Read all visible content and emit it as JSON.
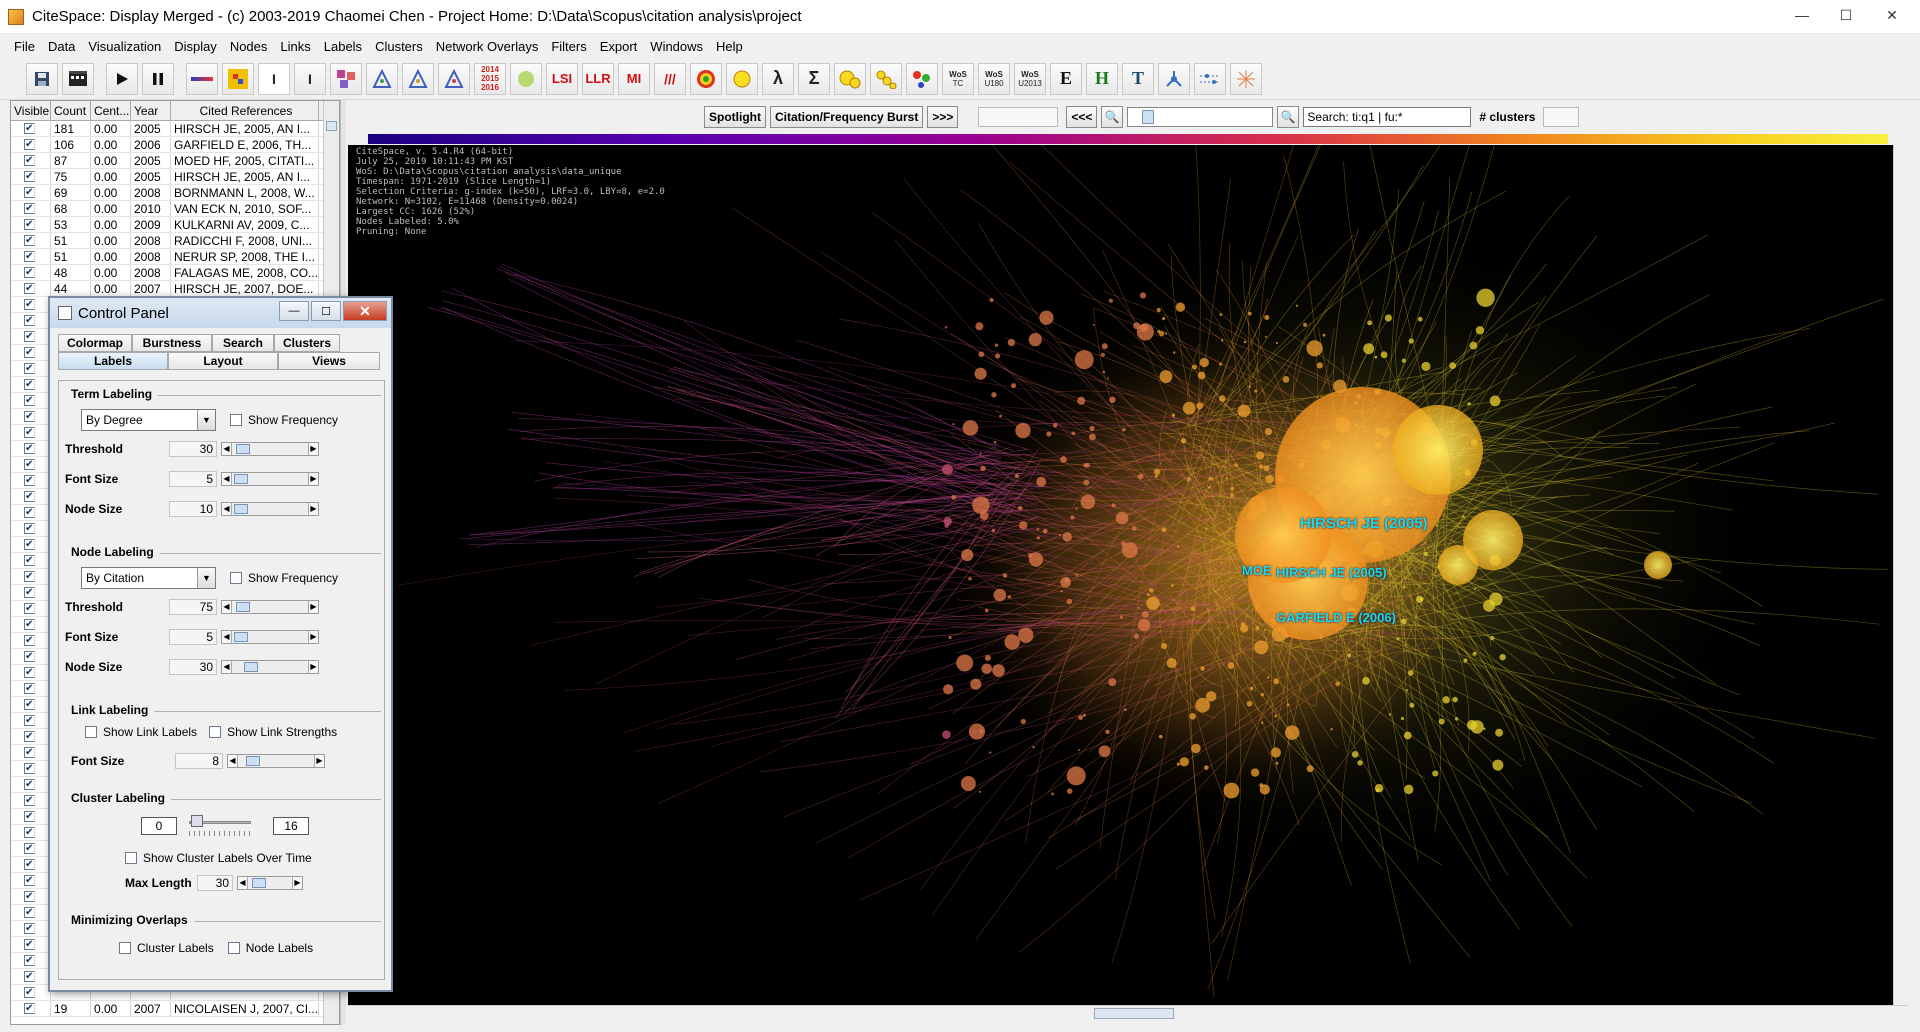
{
  "window": {
    "title": "CiteSpace: Display Merged - (c) 2003-2019 Chaomei Chen - Project Home: D:\\Data\\Scopus\\citation analysis\\project",
    "minimize": "—",
    "maximize": "☐",
    "close": "✕"
  },
  "menu": [
    "File",
    "Data",
    "Visualization",
    "Display",
    "Nodes",
    "Links",
    "Labels",
    "Clusters",
    "Network Overlays",
    "Filters",
    "Export",
    "Windows",
    "Help"
  ],
  "toolbar": {
    "year_stack": [
      "2014",
      "2015",
      "2016"
    ],
    "lsi": "LSI",
    "llr": "LLR",
    "mi": "MI",
    "lambda": "λ",
    "sigma": "Σ",
    "wos_tc": [
      "WoS",
      "TC"
    ],
    "wos_u180": [
      "WoS",
      "U180"
    ],
    "wos_u2013": [
      "WoS",
      "U2013"
    ],
    "e": "E",
    "h": "H",
    "t": "T"
  },
  "table": {
    "headers": [
      "Visible",
      "Count",
      "Cent...",
      "Year",
      "Cited References"
    ],
    "rows": [
      {
        "count": "181",
        "cent": "0.00",
        "year": "2005",
        "ref": "HIRSCH JE, 2005, AN I..."
      },
      {
        "count": "106",
        "cent": "0.00",
        "year": "2006",
        "ref": "GARFIELD E, 2006, TH..."
      },
      {
        "count": "87",
        "cent": "0.00",
        "year": "2005",
        "ref": "MOED HF, 2005, CITATI..."
      },
      {
        "count": "75",
        "cent": "0.00",
        "year": "2005",
        "ref": "HIRSCH JE, 2005, AN I..."
      },
      {
        "count": "69",
        "cent": "0.00",
        "year": "2008",
        "ref": "BORNMANN L, 2008, W..."
      },
      {
        "count": "68",
        "cent": "0.00",
        "year": "2010",
        "ref": "VAN ECK N, 2010, SOF..."
      },
      {
        "count": "53",
        "cent": "0.00",
        "year": "2009",
        "ref": "KULKARNI AV, 2009, C..."
      },
      {
        "count": "51",
        "cent": "0.00",
        "year": "2008",
        "ref": "RADICCHI F, 2008, UNI..."
      },
      {
        "count": "51",
        "cent": "0.00",
        "year": "2008",
        "ref": "NERUR SP, 2008, THE I..."
      },
      {
        "count": "48",
        "cent": "0.00",
        "year": "2008",
        "ref": "FALAGAS ME, 2008, CO..."
      },
      {
        "count": "44",
        "cent": "0.00",
        "year": "2007",
        "ref": "HIRSCH JE, 2007, DOE..."
      }
    ],
    "last_row": {
      "count": "19",
      "cent": "0.00",
      "year": "2007",
      "ref": "NICOLAISEN J, 2007, CI..."
    }
  },
  "viz_toolbar": {
    "spotlight": "Spotlight",
    "burst": "Citation/Frequency Burst",
    "next": ">>>",
    "prev": "<<<",
    "search_value": "Search: ti:q1 | fu:*",
    "clusters_label": "# clusters"
  },
  "canvas_info": [
    "CiteSpace, v. 5.4.R4 (64-bit)",
    "July 25, 2019 10:11:43 PM KST",
    "WoS: D:\\Data\\Scopus\\citation analysis\\data_unique",
    "Timespan: 1971-2019 (Slice Length=1)",
    "Selection Criteria: g-index (k=50), LRF=3.0, LBY=8, e=2.0",
    "Network: N=3102, E=11468 (Density=0.0024)",
    "Largest CC: 1626 (52%)",
    "Nodes Labeled: 5.0%",
    "Pruning: None"
  ],
  "node_labels": {
    "hirsch1": "HIRSCH JE (2005)",
    "moed": "MOE",
    "hirsch2": "HIRSCH JE (2005)",
    "garfield": "GARFIELD E (2006)"
  },
  "control_panel": {
    "title": "Control Panel",
    "tabs_row1": [
      "Colormap",
      "Burstness",
      "Search",
      "Clusters"
    ],
    "tabs_row2": [
      "Labels",
      "Layout",
      "Views"
    ],
    "term_labeling": {
      "heading": "Term Labeling",
      "dropdown": "By Degree",
      "show_frequency": "Show Frequency",
      "threshold_label": "Threshold",
      "threshold": "30",
      "font_label": "Font Size",
      "font": "5",
      "node_label": "Node Size",
      "node": "10"
    },
    "node_labeling": {
      "heading": "Node Labeling",
      "dropdown": "By Citation",
      "show_frequency": "Show Frequency",
      "threshold_label": "Threshold",
      "threshold": "75",
      "font_label": "Font Size",
      "font": "5",
      "node_label": "Node Size",
      "node": "30"
    },
    "link_labeling": {
      "heading": "Link Labeling",
      "show_link_labels": "Show Link Labels",
      "show_link_strengths": "Show Link Strengths",
      "font_label": "Font Size",
      "font": "8"
    },
    "cluster_labeling": {
      "heading": "Cluster Labeling",
      "min": "0",
      "max": "16",
      "show_over_time": "Show Cluster Labels Over Time",
      "max_length_label": "Max Length",
      "max_length": "30"
    },
    "minimizing_overlaps": {
      "heading": "Minimizing Overlaps",
      "cluster_labels": "Cluster Labels",
      "node_labels": "Node Labels"
    }
  },
  "colors": {
    "label_cyan": "#19d9e6",
    "canvas_bg": "#000000"
  }
}
